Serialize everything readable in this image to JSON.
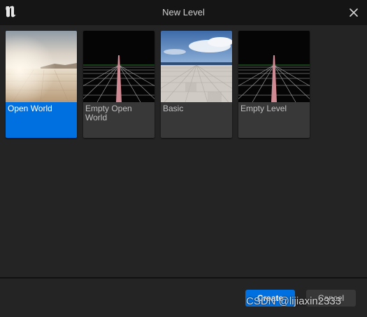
{
  "window": {
    "title": "New Level"
  },
  "icons": {
    "logo": "unreal-engine-logo",
    "close": "close-icon"
  },
  "templates": [
    {
      "label": "Open World",
      "selected": true,
      "thumbnail": "desert-landscape"
    },
    {
      "label": "Empty Open World",
      "selected": false,
      "thumbnail": "empty-grid"
    },
    {
      "label": "Basic",
      "selected": false,
      "thumbnail": "sky-and-floor"
    },
    {
      "label": "Empty Level",
      "selected": false,
      "thumbnail": "empty-grid"
    }
  ],
  "footer": {
    "create_label": "Create",
    "cancel_label": "Cancel"
  },
  "watermark": "CSDN @lijiaxin2333",
  "colors": {
    "accent": "#0070e0",
    "background": "#242424",
    "titlebar": "#151515",
    "tile": "#383838"
  }
}
